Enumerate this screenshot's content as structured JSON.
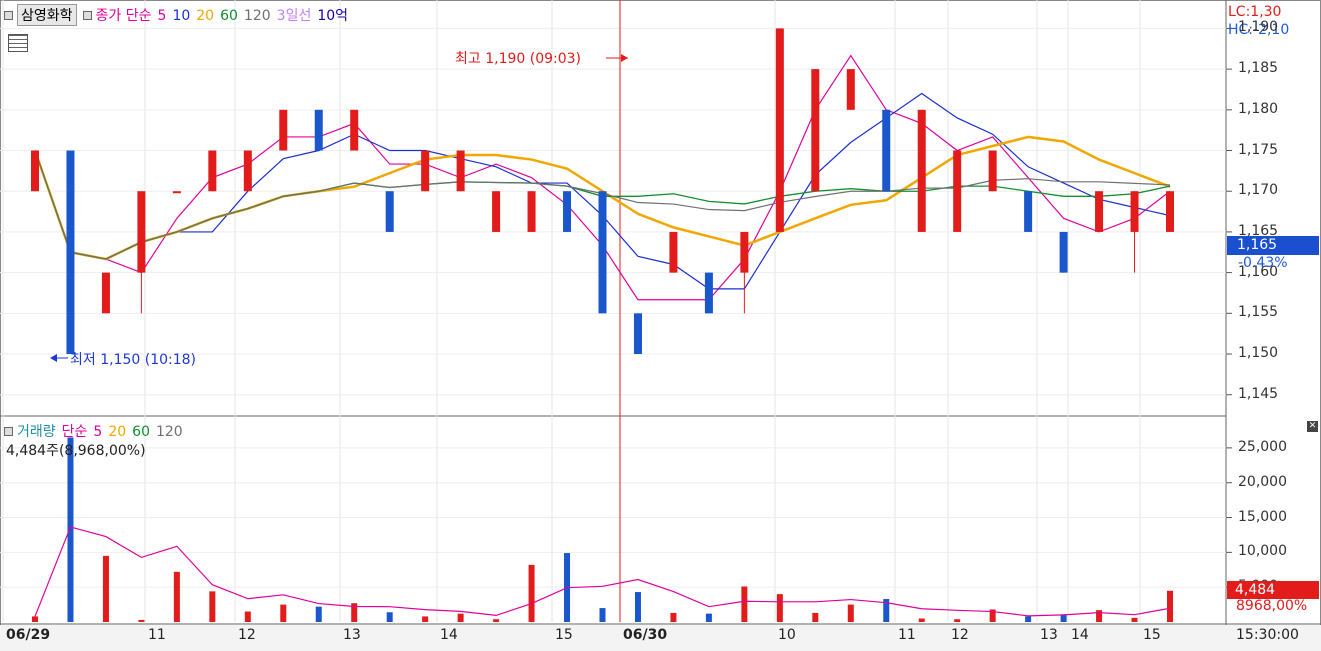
{
  "price_panel": {
    "stock_name": "삼영화학",
    "legend": [
      {
        "label": "종가 단순",
        "color": "#e0009a"
      },
      {
        "label": "5",
        "color": "#e0009a"
      },
      {
        "label": "10",
        "color": "#1a2fd0"
      },
      {
        "label": "20",
        "color": "#f0a800"
      },
      {
        "label": "60",
        "color": "#109030"
      },
      {
        "label": "120",
        "color": "#707070"
      },
      {
        "label": "3일선",
        "color": "#c080ff"
      },
      {
        "label": "10억",
        "color": "#2000a0"
      }
    ],
    "lc_label": "LC:1,30",
    "hc_label": "HC:-2,10",
    "high_annotation": "최고 1,190 (09:03)",
    "low_annotation": "최저 1,150 (10:18)",
    "current_price": "1,165",
    "change_pct": "-0.43%",
    "y_ticks": [
      "1,190",
      "1,185",
      "1,180",
      "1,175",
      "1,170",
      "1,165",
      "1,160",
      "1,155",
      "1,150",
      "1,145"
    ]
  },
  "volume_panel": {
    "legend": [
      {
        "label": "거래량",
        "color": "#2090a0"
      },
      {
        "label": "단순",
        "color": "#e0009a"
      },
      {
        "label": "5",
        "color": "#e0009a"
      },
      {
        "label": "20",
        "color": "#f0a800"
      },
      {
        "label": "60",
        "color": "#109030"
      },
      {
        "label": "120",
        "color": "#707070"
      }
    ],
    "info": "4,484주(8,968,00%)",
    "y_ticks": [
      "25,000",
      "20,000",
      "15,000",
      "10,000",
      "5,000"
    ],
    "current_volume": "4,484",
    "current_ratio": "8968,00%"
  },
  "x_axis": {
    "labels": [
      {
        "text": "06/29",
        "bold": true
      },
      {
        "text": "11",
        "bold": false
      },
      {
        "text": "12",
        "bold": false
      },
      {
        "text": "13",
        "bold": false
      },
      {
        "text": "14",
        "bold": false
      },
      {
        "text": "15",
        "bold": false
      },
      {
        "text": "06/30",
        "bold": true
      },
      {
        "text": "10",
        "bold": false
      },
      {
        "text": "11",
        "bold": false
      },
      {
        "text": "12",
        "bold": false
      },
      {
        "text": "13",
        "bold": false
      },
      {
        "text": "14",
        "bold": false
      },
      {
        "text": "15",
        "bold": false
      }
    ],
    "time_label": "15:30:00"
  },
  "chart_data": {
    "type": "candlestick",
    "price_unit": "KRW",
    "ylim": [
      1143,
      1193
    ],
    "candles": [
      {
        "o": 1170,
        "c": 1175,
        "h": 1175,
        "l": 1170,
        "d": 1
      },
      {
        "o": 1175,
        "c": 1150,
        "h": 1175,
        "l": 1150,
        "d": -1
      },
      {
        "o": 1155,
        "c": 1160,
        "h": 1160,
        "l": 1155,
        "d": 1
      },
      {
        "o": 1160,
        "c": 1170,
        "h": 1170,
        "l": 1155,
        "d": 1
      },
      {
        "o": 1170,
        "c": 1170,
        "h": 1170,
        "l": 1170,
        "d": 0
      },
      {
        "o": 1170,
        "c": 1175,
        "h": 1175,
        "l": 1170,
        "d": 1
      },
      {
        "o": 1170,
        "c": 1175,
        "h": 1175,
        "l": 1170,
        "d": 1
      },
      {
        "o": 1175,
        "c": 1180,
        "h": 1180,
        "l": 1175,
        "d": 1
      },
      {
        "o": 1180,
        "c": 1175,
        "h": 1180,
        "l": 1175,
        "d": -1
      },
      {
        "o": 1175,
        "c": 1180,
        "h": 1180,
        "l": 1175,
        "d": 1
      },
      {
        "o": 1170,
        "c": 1165,
        "h": 1170,
        "l": 1165,
        "d": -1
      },
      {
        "o": 1170,
        "c": 1175,
        "h": 1175,
        "l": 1170,
        "d": 1
      },
      {
        "o": 1170,
        "c": 1175,
        "h": 1175,
        "l": 1170,
        "d": 1
      },
      {
        "o": 1165,
        "c": 1170,
        "h": 1170,
        "l": 1165,
        "d": 1
      },
      {
        "o": 1165,
        "c": 1170,
        "h": 1170,
        "l": 1165,
        "d": 1
      },
      {
        "o": 1170,
        "c": 1165,
        "h": 1170,
        "l": 1165,
        "d": -1
      },
      {
        "o": 1170,
        "c": 1155,
        "h": 1170,
        "l": 1155,
        "d": -1
      },
      {
        "o": 1155,
        "c": 1150,
        "h": 1155,
        "l": 1150,
        "d": -1
      },
      {
        "o": 1160,
        "c": 1165,
        "h": 1165,
        "l": 1160,
        "d": 1
      },
      {
        "o": 1160,
        "c": 1155,
        "h": 1160,
        "l": 1155,
        "d": -1
      },
      {
        "o": 1160,
        "c": 1165,
        "h": 1165,
        "l": 1155,
        "d": 1
      },
      {
        "o": 1165,
        "c": 1190,
        "h": 1190,
        "l": 1165,
        "d": 1
      },
      {
        "o": 1170,
        "c": 1185,
        "h": 1185,
        "l": 1170,
        "d": 1
      },
      {
        "o": 1180,
        "c": 1185,
        "h": 1185,
        "l": 1180,
        "d": 1
      },
      {
        "o": 1180,
        "c": 1170,
        "h": 1180,
        "l": 1170,
        "d": -1
      },
      {
        "o": 1165,
        "c": 1180,
        "h": 1180,
        "l": 1165,
        "d": 1
      },
      {
        "o": 1165,
        "c": 1175,
        "h": 1175,
        "l": 1165,
        "d": 1
      },
      {
        "o": 1170,
        "c": 1175,
        "h": 1175,
        "l": 1170,
        "d": 1
      },
      {
        "o": 1170,
        "c": 1165,
        "h": 1170,
        "l": 1165,
        "d": -1
      },
      {
        "o": 1165,
        "c": 1160,
        "h": 1165,
        "l": 1160,
        "d": -1
      },
      {
        "o": 1165,
        "c": 1170,
        "h": 1170,
        "l": 1165,
        "d": 1
      },
      {
        "o": 1165,
        "c": 1170,
        "h": 1170,
        "l": 1160,
        "d": 1
      },
      {
        "o": 1165,
        "c": 1170,
        "h": 1170,
        "l": 1165,
        "d": 1
      }
    ],
    "volume": [
      800,
      26500,
      9500,
      300,
      7200,
      4400,
      1500,
      2500,
      2200,
      2700,
      1400,
      800,
      1200,
      400,
      8200,
      9900,
      2000,
      4300,
      1300,
      1200,
      5100,
      4000,
      1300,
      2500,
      3300,
      500,
      400,
      1800,
      800,
      1100,
      1700,
      600,
      4484
    ],
    "volume_ylim": [
      0,
      28000
    ]
  }
}
